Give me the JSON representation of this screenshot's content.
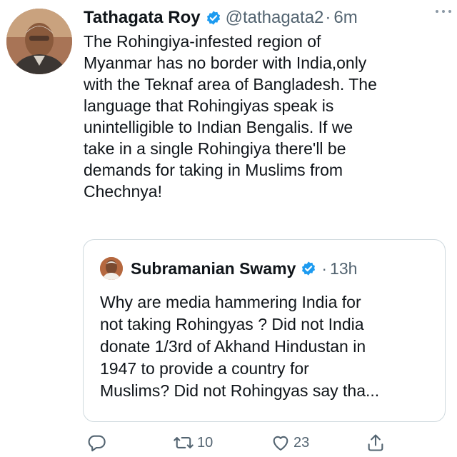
{
  "tweet": {
    "author_name": "Tathagata Roy",
    "handle": "@tathagata2",
    "separator": "·",
    "time": "6m",
    "text": "The Rohingiya-infested region of\nMyanmar has no border with India,only\nwith the Teknaf area of Bangladesh. The\nlanguage that Rohingiyas speak is\nunintelligible to Indian Bengalis. If we\ntake in a single Rohingiya there'll be\ndemands for taking in Muslims from\nChechnya!"
  },
  "quote": {
    "author_name": "Subramanian Swamy",
    "separator": "·",
    "time": "13h",
    "text": "Why are media hammering India for\nnot taking Rohingyas ? Did not India\ndonate 1/3rd of Akhand Hindustan in\n1947 to provide a country for\nMuslims? Did not Rohingyas say tha..."
  },
  "actions": {
    "reply_icon": "reply-icon",
    "retweet_icon": "retweet-icon",
    "retweet_count": "10",
    "like_icon": "heart-icon",
    "like_count": "23",
    "share_icon": "share-icon"
  },
  "colors": {
    "verified": "#1d9bf0",
    "secondary_text": "#536471",
    "border": "#cfd9de"
  }
}
